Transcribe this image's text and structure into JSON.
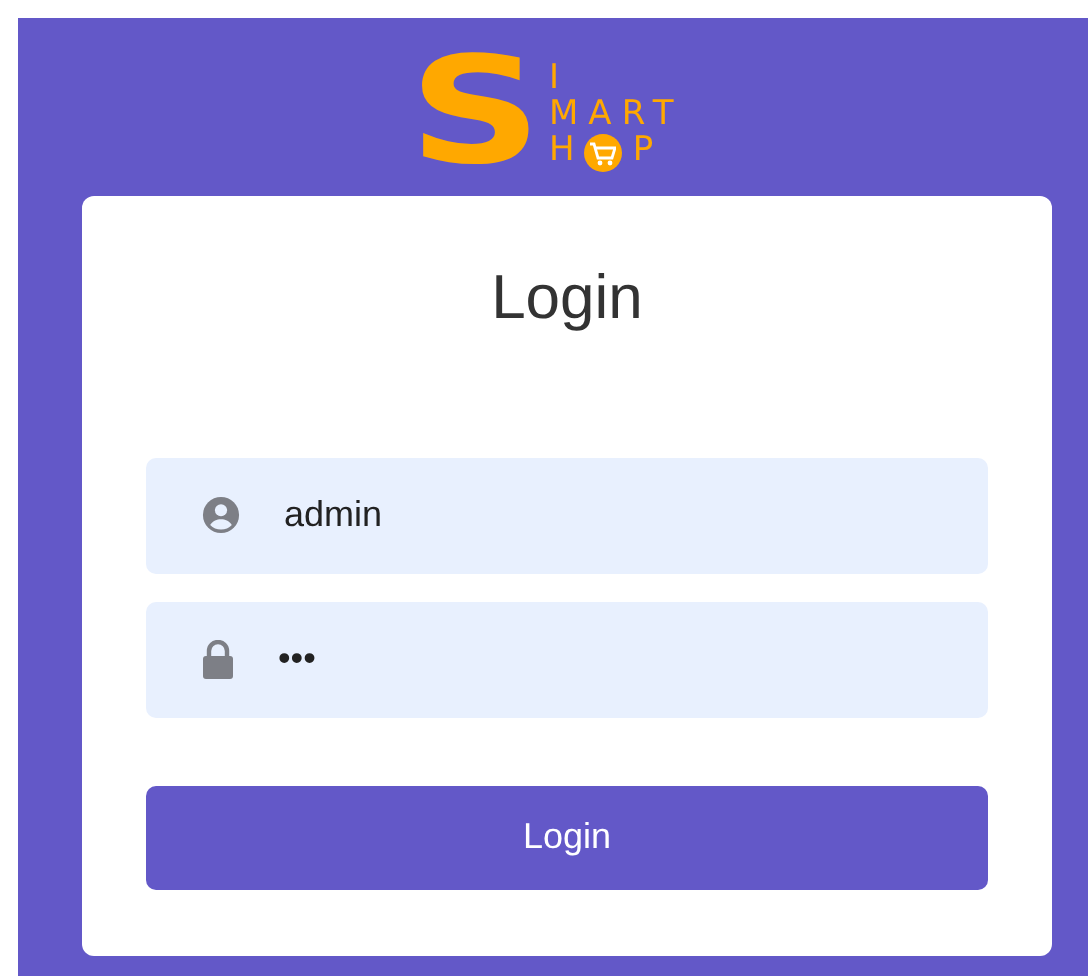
{
  "logo": {
    "big_letter": "S",
    "line_1": "I",
    "line_2": "MART",
    "line_3_start": "H",
    "line_3_end": "P"
  },
  "title": "Login",
  "fields": [
    {
      "kind": "user",
      "value": "admin"
    },
    {
      "kind": "lock",
      "value": "•••"
    }
  ],
  "button": "Login"
}
